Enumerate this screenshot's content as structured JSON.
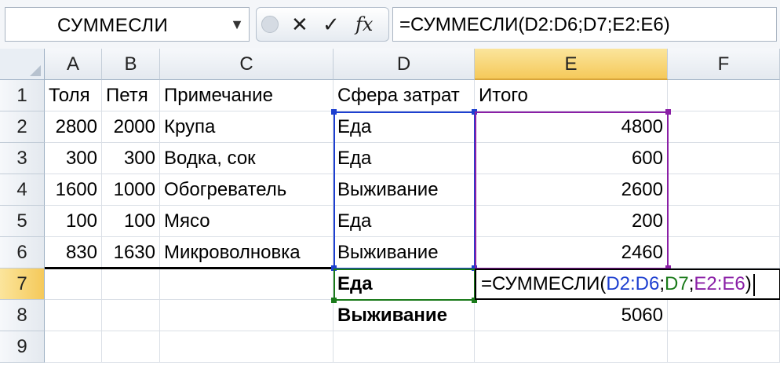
{
  "name_box": {
    "value": "СУММЕСЛИ"
  },
  "formula_bar": {
    "cancel_glyph": "✕",
    "enter_glyph": "✓",
    "fx_label": "fx",
    "formula": "=СУММЕСЛИ(D2:D6;D7;E2:E6)"
  },
  "columns": [
    "A",
    "B",
    "C",
    "D",
    "E",
    "F"
  ],
  "rows": [
    "1",
    "2",
    "3",
    "4",
    "5",
    "6",
    "7",
    "8",
    "9"
  ],
  "cells": {
    "r1": {
      "a": "Толя",
      "b": "Петя",
      "c": "Примечание",
      "d": "Сфера затрат",
      "e": "Итого"
    },
    "r2": {
      "a": "2800",
      "b": "2000",
      "c": "Крупа",
      "d": "Еда",
      "e": "4800"
    },
    "r3": {
      "a": "300",
      "b": "300",
      "c": "Водка, сок",
      "d": "Еда",
      "e": "600"
    },
    "r4": {
      "a": "1600",
      "b": "1000",
      "c": "Обогреватель",
      "d": "Выживание",
      "e": "2600"
    },
    "r5": {
      "a": "100",
      "b": "100",
      "c": "Мясо",
      "d": "Еда",
      "e": "200"
    },
    "r6": {
      "a": "830",
      "b": "1630",
      "c": "Микроволновка",
      "d": "Выживание",
      "e": "2460"
    },
    "r7": {
      "d": "Еда"
    },
    "r8": {
      "d": "Выживание",
      "e": "5060"
    }
  },
  "edit_formula": {
    "prefix": "=СУММЕСЛИ(",
    "range1": "D2:D6",
    "sep1": ";",
    "criteria": "D7",
    "sep2": ";",
    "range2": "E2:E6",
    "suffix": ")"
  },
  "colors": {
    "active_header": "#f5c95a",
    "ref_blue": "#1d3fd0",
    "ref_green": "#1a7a1a",
    "ref_purple": "#8a1fa6"
  },
  "active_cell": "E7"
}
